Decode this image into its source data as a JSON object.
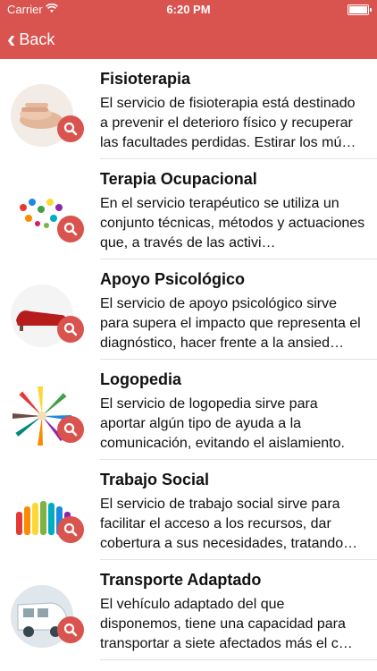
{
  "status_bar": {
    "carrier": "Carrier",
    "time": "6:20 PM"
  },
  "header": {
    "back_label": "Back"
  },
  "services": [
    {
      "title": "Fisioterapia",
      "description": "El servicio de fisioterapia está destinado a prevenir el deterioro físico y recuperar las facultades perdidas. Estirar los mú…",
      "icon": "hands-icon"
    },
    {
      "title": "Terapia Ocupacional",
      "description": "En el servicio terapéutico se utiliza un conjunto técnicas, métodos y actuaciones que, a través de las activi…",
      "icon": "colorful-hands-icon"
    },
    {
      "title": "Apoyo Psicológico",
      "description": "El servicio de apoyo psicológico sirve para supera el impacto que representa el diagnóstico, hacer frente a la ansied…",
      "icon": "couch-icon"
    },
    {
      "title": "Logopedia",
      "description": "El servicio de logopedia sirve para aportar algún tipo de ayuda a la comunicación, evitando el aislamiento.",
      "icon": "pencils-icon"
    },
    {
      "title": "Trabajo Social",
      "description": "El servicio de trabajo social sirve para facilitar el acceso a los recursos, dar cobertura a sus necesidades, tratando…",
      "icon": "raised-hands-icon"
    },
    {
      "title": "Transporte Adaptado",
      "description": "El vehículo adaptado del que disponemos, tiene una capacidad para transportar a siete afectados más el c…",
      "icon": "van-icon"
    }
  ],
  "colors": {
    "accent": "#d9534f"
  }
}
